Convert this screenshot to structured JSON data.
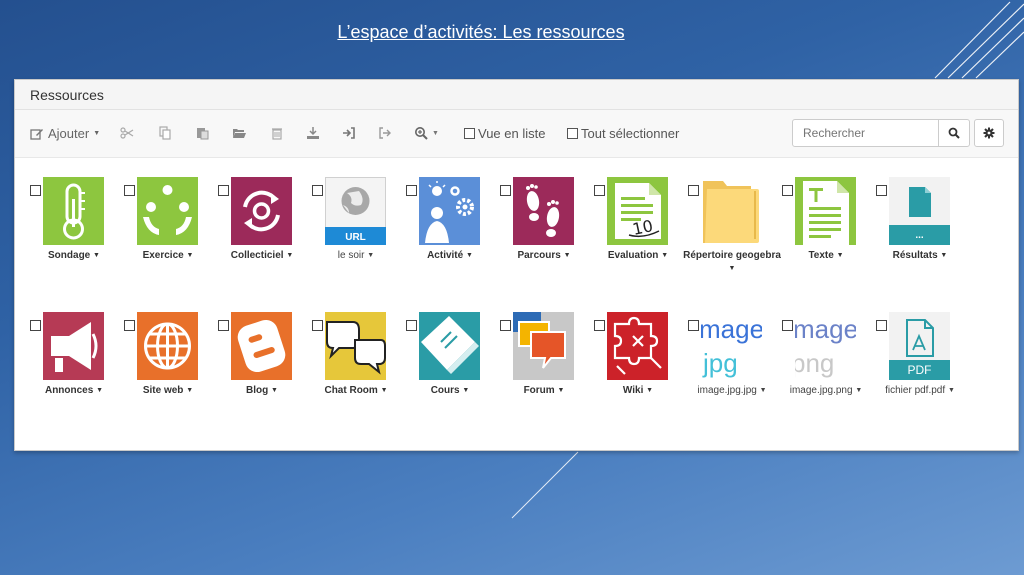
{
  "slide": {
    "title": "L’espace d’activités: Les ressources"
  },
  "panel": {
    "title": "Ressources"
  },
  "toolbar": {
    "add_label": "Ajouter",
    "list_view_label": "Vue en liste",
    "select_all_label": "Tout sélectionner",
    "search_placeholder": "Rechercher"
  },
  "colors": {
    "green": "#8dc63f",
    "maroon": "#9c2a5a",
    "blue": "#5b8fd8",
    "orange": "#e8702a",
    "yellow": "#e6c73a",
    "teal": "#2a9ca6",
    "red": "#cc2229",
    "annonces": "#b63a55"
  },
  "row1": [
    {
      "label": "Sondage",
      "icon": "thermometer-icon"
    },
    {
      "label": "Exercice",
      "icon": "exercise-people-icon"
    },
    {
      "label": "Collecticiel",
      "icon": "cycle-arrows-icon"
    },
    {
      "label": "le soir",
      "icon": "url-globe-icon",
      "badge": "URL"
    },
    {
      "label": "Activité",
      "icon": "activity-ideas-icon"
    },
    {
      "label": "Parcours",
      "icon": "footprints-icon"
    },
    {
      "label": "Evaluation",
      "icon": "grade-sheet-icon",
      "grade": "10"
    },
    {
      "label": "Répertoire geogebra",
      "icon": "folder-icon"
    },
    {
      "label": "Texte",
      "icon": "text-document-icon"
    },
    {
      "label": "Résultats",
      "icon": "file-results-icon",
      "badge": "..."
    }
  ],
  "row2": [
    {
      "label": "Annonces",
      "icon": "megaphone-icon"
    },
    {
      "label": "Site web",
      "icon": "globe-icon"
    },
    {
      "label": "Blog",
      "icon": "blogger-icon"
    },
    {
      "label": "Chat Room",
      "icon": "chat-bubbles-icon"
    },
    {
      "label": "Cours",
      "icon": "course-book-icon"
    },
    {
      "label": "Forum",
      "icon": "forum-bubbles-icon"
    },
    {
      "label": "Wiki",
      "icon": "puzzle-icon"
    },
    {
      "label": "image.jpg.jpg",
      "icon": "image-jpg-icon",
      "preview": [
        "mage",
        "jpg"
      ]
    },
    {
      "label": "image.jpg.png",
      "icon": "image-png-icon",
      "preview": [
        "mage",
        "png"
      ]
    },
    {
      "label": "fichier pdf.pdf",
      "icon": "pdf-file-icon",
      "badge": "PDF"
    }
  ]
}
